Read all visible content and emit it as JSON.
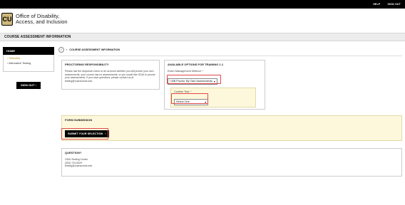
{
  "topnav": {
    "help": "HELP",
    "sign_out": "SIGN OUT"
  },
  "logo": {
    "line1": "Office of Disability,",
    "line2": "Access, and Inclusion"
  },
  "page": {
    "title": "COURSE ASSESSMENT INFORMATION"
  },
  "sidebar": {
    "home": "HOME",
    "items": [
      {
        "label": "Overview",
        "active": true
      },
      {
        "label": "Alternative Testing",
        "active": false
      }
    ],
    "sign_out": "SIGN OUT"
  },
  "breadcrumb": {
    "current": "COURSE ASSESSMENT INFORMATION"
  },
  "proctoring": {
    "title": "PROCTORING RESPONSIBILITY",
    "body": "Please use the dropdown menu to let us know whether you will proctor your own assessments, your course has no assessments, or you would like ODAI to proctor your assessments. If you have questions, please contact us at testing@cuanschutz.edu."
  },
  "options": {
    "title": "AVAILABLE OPTIONS FOR TRAINING 1.1",
    "exam_method_label": "Exam Management Method",
    "exam_method_value": "I Will Proctor My Own Assessments",
    "confirm_label": "Confirm Test",
    "confirm_value": "Select One"
  },
  "form": {
    "title": "FORM SUBMISSION",
    "submit": "SUBMIT YOUR SELECTION"
  },
  "question": {
    "title": "QUESTION?",
    "lines": [
      "ODAI Testing Center",
      "(303) 724-8429",
      "testing@cuanschutz.edu"
    ]
  },
  "colors": {
    "accent": "#cfb87c",
    "highlight": "#e04848",
    "yellow_panel": "#fdf8dc"
  }
}
